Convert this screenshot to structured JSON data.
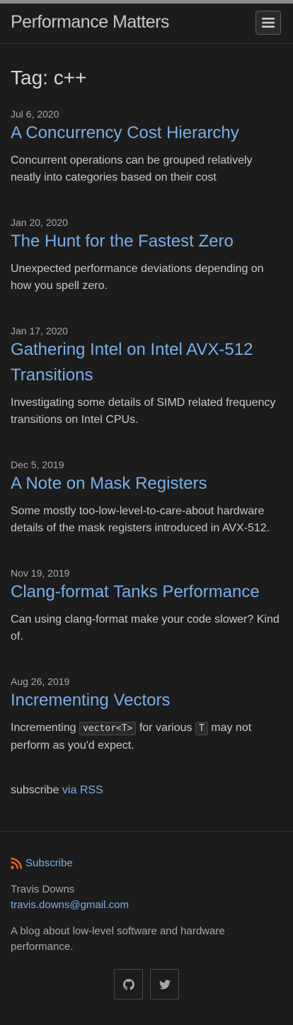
{
  "header": {
    "site_title": "Performance Matters",
    "menu_icon": "hamburger-icon"
  },
  "page": {
    "heading": "Tag: c++"
  },
  "posts": [
    {
      "date": "Jul 6, 2020",
      "title": "A Concurrency Cost Hierarchy",
      "excerpt": "Concurrent operations can be grouped relatively neatly into categories based on their cost"
    },
    {
      "date": "Jan 20, 2020",
      "title": "The Hunt for the Fastest Zero",
      "excerpt": "Unexpected performance deviations depending on how you spell zero."
    },
    {
      "date": "Jan 17, 2020",
      "title": "Gathering Intel on Intel AVX-512 Transitions",
      "excerpt": "Investigating some details of SIMD related frequency transitions on Intel CPUs."
    },
    {
      "date": "Dec 5, 2019",
      "title": "A Note on Mask Registers",
      "excerpt": "Some mostly too-low-level-to-care-about hardware details of the mask registers introduced in AVX-512."
    },
    {
      "date": "Nov 19, 2019",
      "title": "Clang-format Tanks Performance",
      "excerpt": "Can using clang-format make your code slower? Kind of."
    },
    {
      "date": "Aug 26, 2019",
      "title": "Incrementing Vectors",
      "excerpt_parts": {
        "before": "Incrementing ",
        "code1": "vector<T>",
        "middle": " for various ",
        "code2": "T",
        "after": " may not perform as you'd expect."
      }
    }
  ],
  "rss": {
    "prefix": "subscribe ",
    "link_label": "via RSS"
  },
  "footer": {
    "subscribe_label": "Subscribe",
    "subscribe_icon": "rss-icon",
    "author_name": "Travis Downs",
    "author_email": "travis.downs@gmail.com",
    "description": "A blog about low-level software and hardware performance.",
    "social": [
      {
        "icon": "github-icon"
      },
      {
        "icon": "twitter-icon"
      }
    ]
  },
  "colors": {
    "background": "#1c1c1c",
    "link": "#78aeea",
    "text": "#c9c9c9",
    "muted": "#a8a8a8",
    "rss_orange": "#f26522"
  }
}
